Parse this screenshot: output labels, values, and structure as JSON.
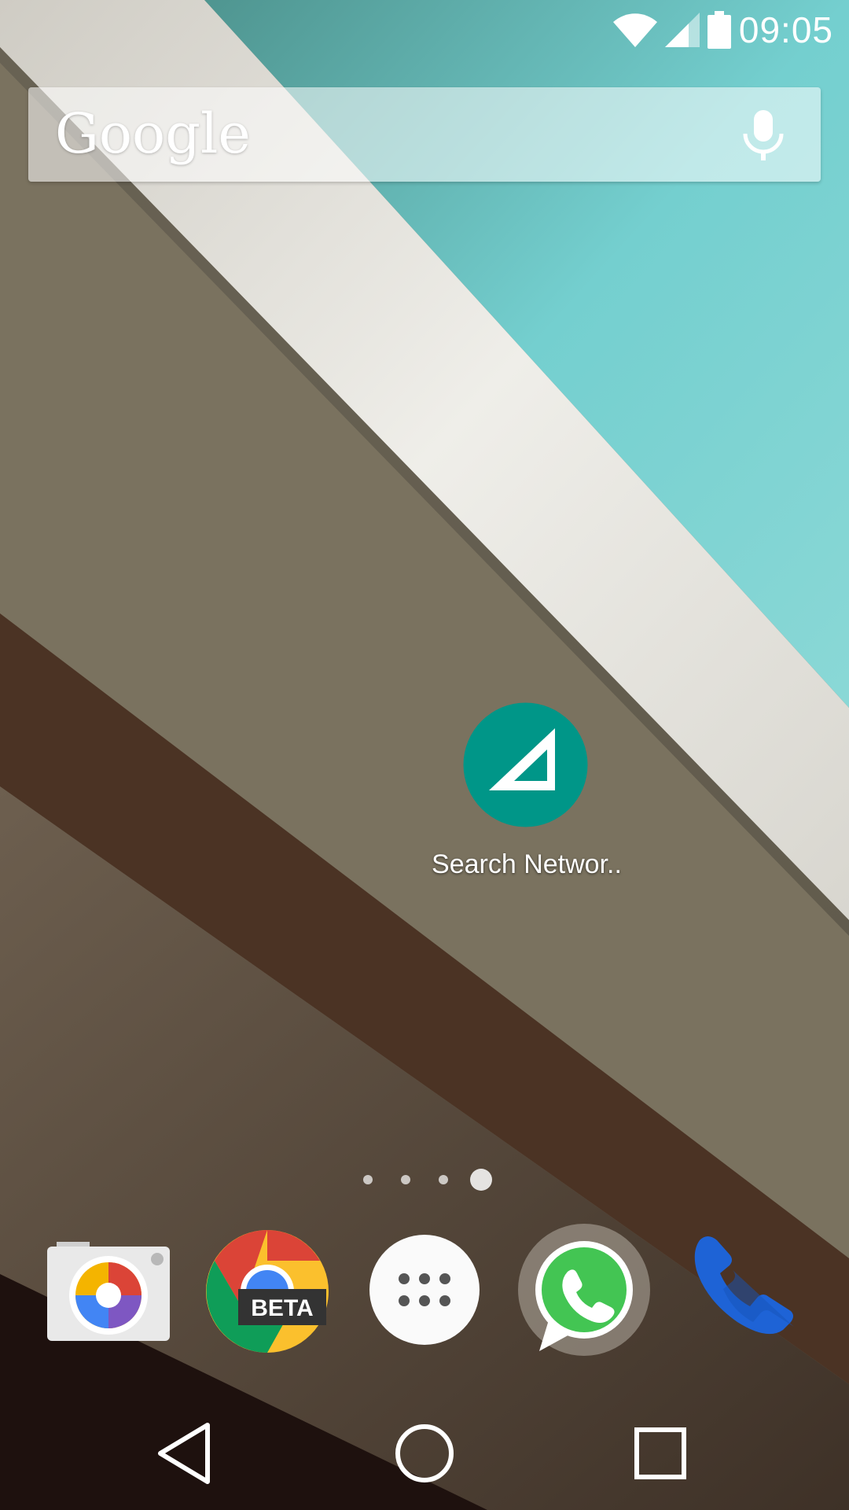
{
  "status_bar": {
    "time": "09:05",
    "icons": [
      "wifi-icon",
      "cell-signal-icon",
      "battery-icon"
    ]
  },
  "search_widget": {
    "logo_text": "Google",
    "mic_icon": "microphone-icon"
  },
  "home_apps": [
    {
      "label": "Search Networ..",
      "icon": "search-network-icon",
      "color": "#009688"
    }
  ],
  "page_indicator": {
    "pages": 4,
    "current": 4
  },
  "dock": [
    {
      "app": "camera",
      "icon": "camera-icon"
    },
    {
      "app": "chrome-beta",
      "icon": "chrome-beta-icon",
      "badge": "BETA"
    },
    {
      "app": "app-drawer",
      "icon": "app-drawer-icon"
    },
    {
      "app": "whatsapp",
      "icon": "whatsapp-icon"
    },
    {
      "app": "phone",
      "icon": "phone-icon"
    }
  ],
  "nav_bar": [
    "back-icon",
    "home-icon",
    "recents-icon"
  ]
}
